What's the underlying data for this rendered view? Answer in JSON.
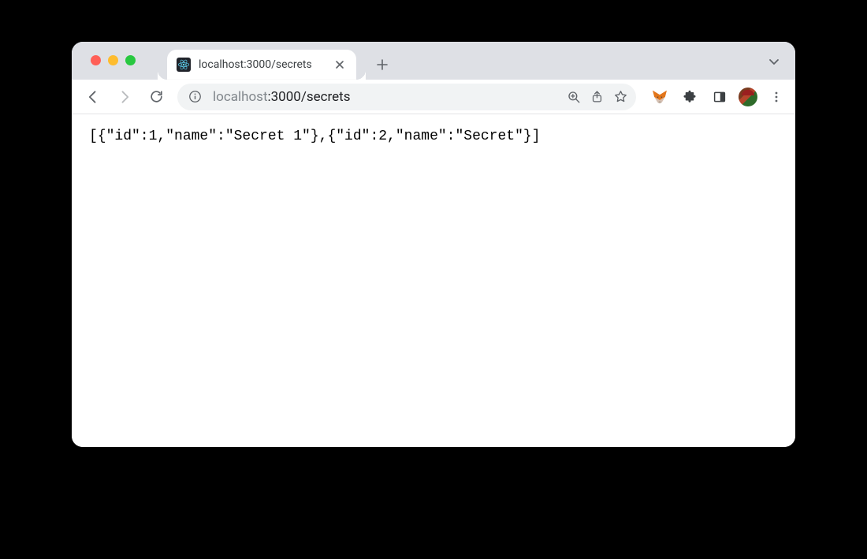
{
  "tab": {
    "title": "localhost:3000/secrets",
    "favicon": "react-icon"
  },
  "toolbar": {
    "url_dim_prefix": "localhost",
    "url_rest": ":3000/secrets"
  },
  "icons": {
    "traffic_red": "window-close",
    "traffic_yellow": "window-minimize",
    "traffic_green": "window-zoom",
    "back": "back",
    "forward": "forward",
    "reload": "reload",
    "info": "site-info",
    "zoom": "zoom",
    "share": "share",
    "star": "bookmark-star",
    "ext_fox": "metamask",
    "ext_puzzle": "extensions-puzzle",
    "ext_panel": "side-panel",
    "avatar": "profile-avatar",
    "menu": "kebab-menu",
    "caret": "tab-search",
    "new_tab": "new-tab",
    "close_tab": "close-tab"
  },
  "page_body": "[{\"id\":1,\"name\":\"Secret 1\"},{\"id\":2,\"name\":\"Secret\"}]",
  "page_json": [
    {
      "id": 1,
      "name": "Secret 1"
    },
    {
      "id": 2,
      "name": "Secret"
    }
  ]
}
